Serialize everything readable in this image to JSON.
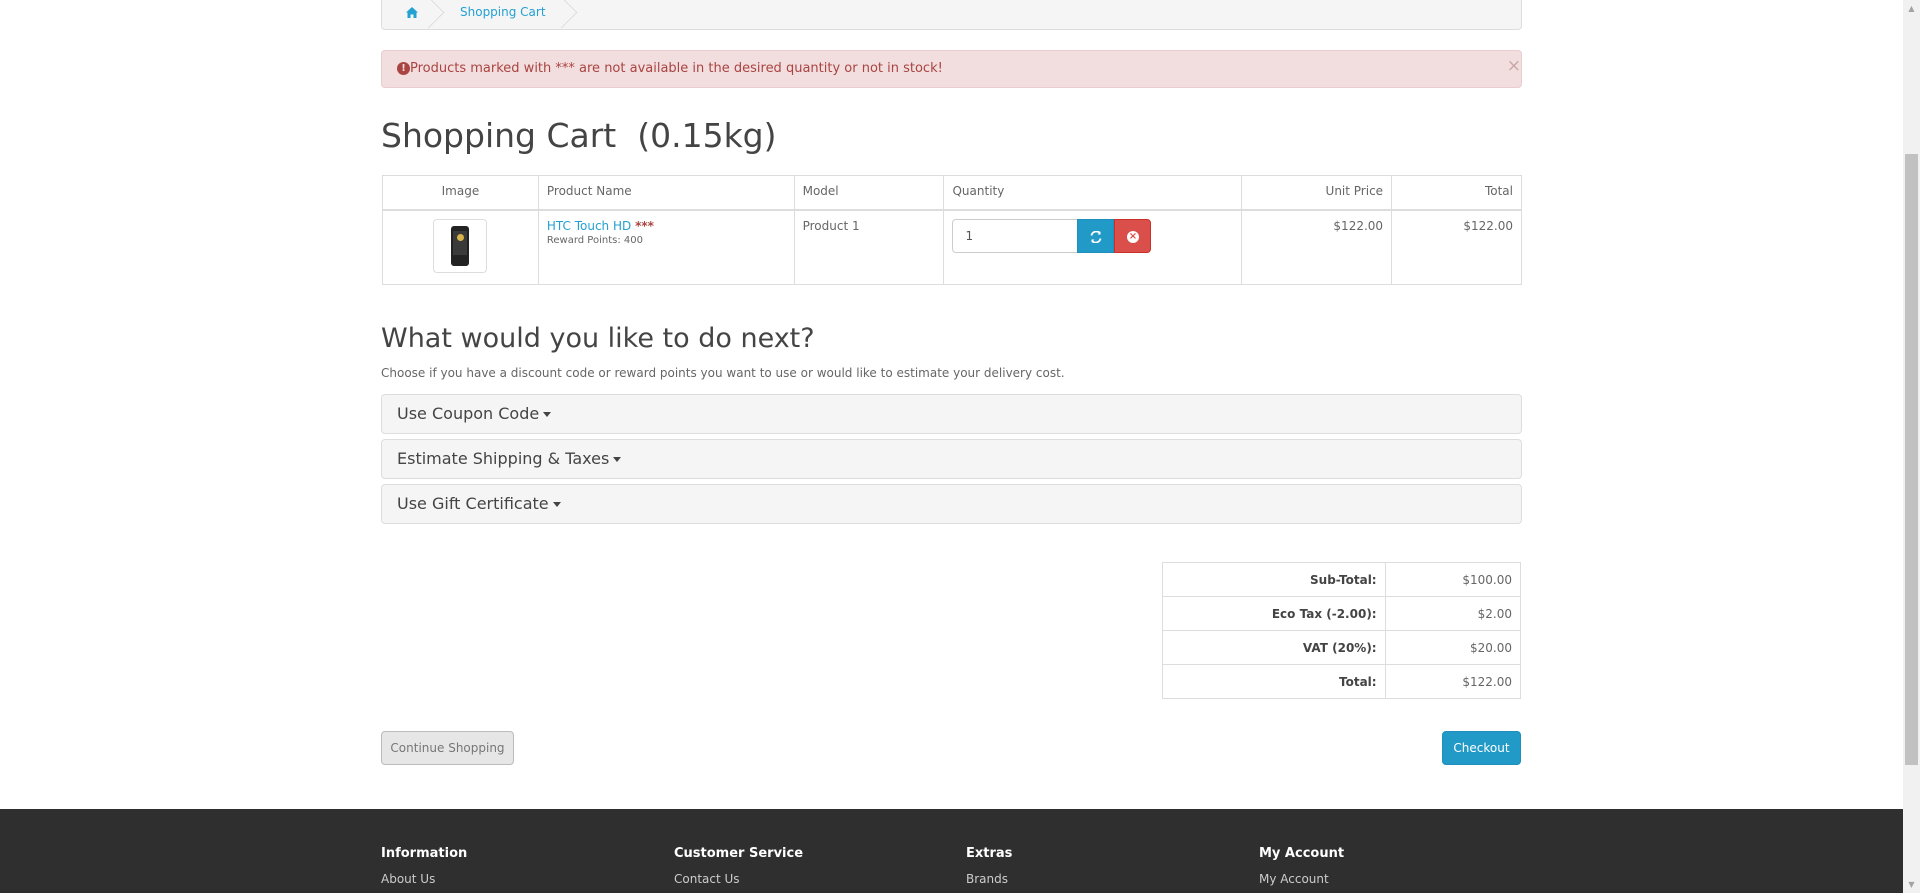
{
  "breadcrumb": {
    "home_icon": "home-icon",
    "current": "Shopping Cart"
  },
  "alert": {
    "text": "Products marked with *** are not available in the desired quantity or not in stock!",
    "close": "×"
  },
  "page_title": "Shopping Cart  (0.15kg)",
  "cart_table": {
    "headers": [
      "Image",
      "Product Name",
      "Model",
      "Quantity",
      "Unit Price",
      "Total"
    ],
    "rows": [
      {
        "product_name": "HTC Touch HD",
        "stock_flag": "***",
        "reward_points": "Reward Points: 400",
        "model": "Product 1",
        "quantity": "1",
        "unit_price": "$122.00",
        "total": "$122.00"
      }
    ]
  },
  "next_section": {
    "title": "What would you like to do next?",
    "description": "Choose if you have a discount code or reward points you want to use or would like to estimate your delivery cost.",
    "panels": [
      "Use Coupon Code",
      "Estimate Shipping & Taxes",
      "Use Gift Certificate"
    ]
  },
  "totals": [
    {
      "label": "Sub-Total:",
      "value": "$100.00"
    },
    {
      "label": "Eco Tax (-2.00):",
      "value": "$2.00"
    },
    {
      "label": "VAT (20%):",
      "value": "$20.00"
    },
    {
      "label": "Total:",
      "value": "$122.00"
    }
  ],
  "buttons": {
    "continue": "Continue Shopping",
    "checkout": "Checkout"
  },
  "footer": {
    "columns": [
      {
        "heading": "Information",
        "first_link": "About Us"
      },
      {
        "heading": "Customer Service",
        "first_link": "Contact Us"
      },
      {
        "heading": "Extras",
        "first_link": "Brands"
      },
      {
        "heading": "My Account",
        "first_link": "My Account"
      }
    ]
  },
  "colors": {
    "link": "#23a1d1",
    "primary_button": "#229ac8",
    "danger_button": "#da4f49",
    "alert_bg": "#f2dede",
    "footer_bg": "#2f2f2f"
  }
}
